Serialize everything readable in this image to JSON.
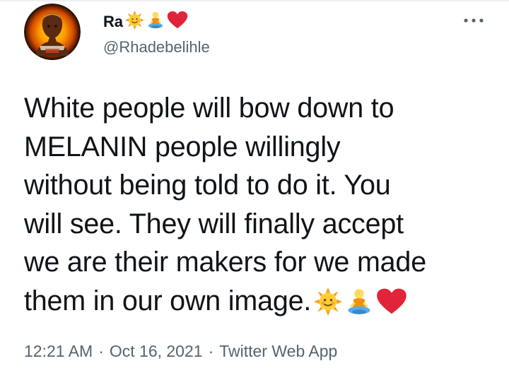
{
  "author": {
    "display_name": "Ra",
    "name_emojis": [
      "sun-with-face-emoji",
      "person-in-lotus-position-emoji",
      "red-heart-emoji"
    ],
    "handle": "@Rhadebelihle"
  },
  "menu": {
    "icon": "more-options-icon"
  },
  "tweet": {
    "text": "White people will bow down to\nMELANIN people willingly\nwithout being told to do it. You\nwill see. They will finally accept\nwe are their makers for we made\nthem in our own image.",
    "trailing_emojis": [
      "sun-with-face-emoji",
      "person-in-lotus-position-emoji",
      "red-heart-emoji"
    ]
  },
  "meta": {
    "time": "12:21 AM",
    "separator": "·",
    "date": "Oct 16, 2021",
    "source": "Twitter Web App"
  },
  "colors": {
    "text": "#0f1419",
    "secondary_text": "#536471",
    "heart": "#e0243a",
    "sun": "#ffcc33",
    "sun_rays": "#f4a11b"
  }
}
